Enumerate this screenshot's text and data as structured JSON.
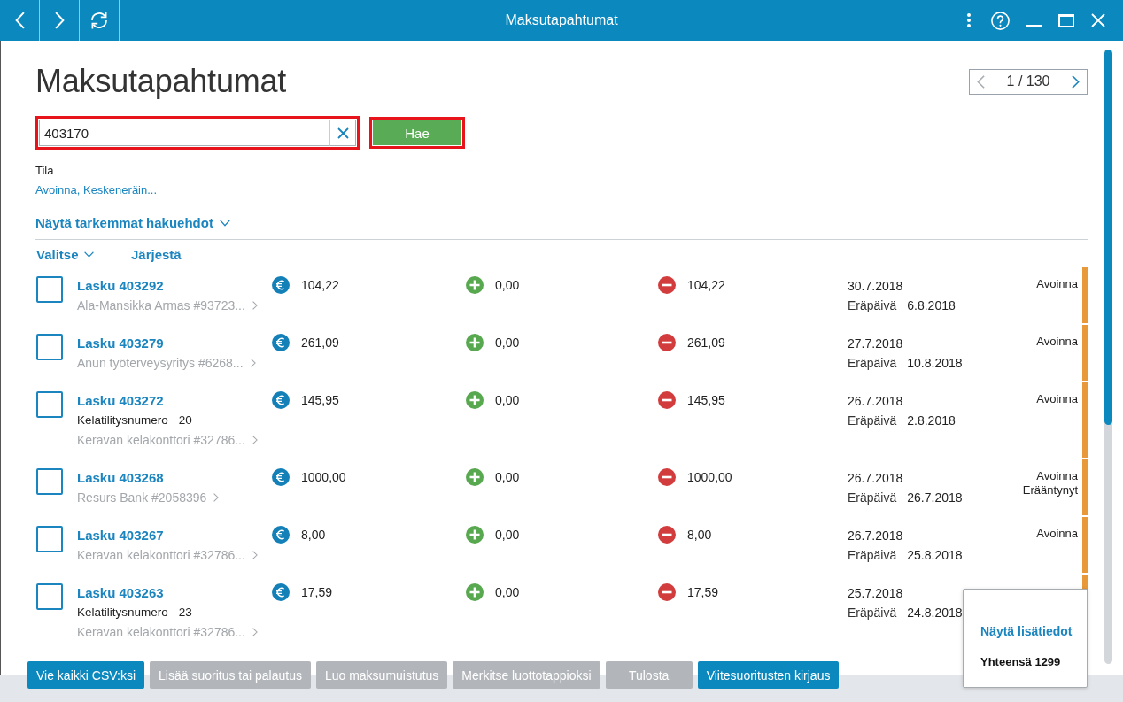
{
  "window": {
    "title": "Maksutapahtumat"
  },
  "page": {
    "title": "Maksutapahtumat",
    "pager": {
      "text": "1 / 130",
      "prev": {
        "disabled": true
      },
      "next": {
        "disabled": false
      }
    }
  },
  "search": {
    "value": "403170",
    "highlighted": true,
    "button": {
      "label": "Hae",
      "highlighted": true
    }
  },
  "filter": {
    "label": "Tila",
    "value": "Avoinna, Keskeneräin..."
  },
  "advanced_toggle": {
    "label": "Näytä tarkemmat hakuehdot",
    "expanded": false
  },
  "list_toolbar": {
    "select": "Valitse",
    "sort": "Järjestä"
  },
  "rows": [
    {
      "checked": false,
      "title": "Lasku 403292",
      "payer": "Ala-Mansikka Armas #93723...",
      "amount": "104,22",
      "paid": "0,00",
      "remaining": "104,22",
      "date": "30.7.2018",
      "due_label": "Eräpäivä",
      "due": "6.8.2018",
      "status": [
        "Avoinna"
      ],
      "color": "#e8993a"
    },
    {
      "checked": false,
      "title": "Lasku 403279",
      "payer": "Anun työterveysyritys #6268...",
      "amount": "261,09",
      "paid": "0,00",
      "remaining": "261,09",
      "date": "27.7.2018",
      "due_label": "Eräpäivä",
      "due": "10.8.2018",
      "status": [
        "Avoinna"
      ],
      "color": "#e8993a"
    },
    {
      "checked": false,
      "title": "Lasku 403272",
      "reference": {
        "label": "Kelatilitysnumero",
        "value": "20"
      },
      "payer": "Keravan kelakonttori #32786...",
      "amount": "145,95",
      "paid": "0,00",
      "remaining": "145,95",
      "date": "26.7.2018",
      "due_label": "Eräpäivä",
      "due": "2.8.2018",
      "status": [
        "Avoinna"
      ],
      "color": "#e8993a"
    },
    {
      "checked": false,
      "title": "Lasku 403268",
      "payer": "Resurs Bank #2058396",
      "amount": "1000,00",
      "paid": "0,00",
      "remaining": "1000,00",
      "date": "26.7.2018",
      "due_label": "Eräpäivä",
      "due": "26.7.2018",
      "status": [
        "Avoinna",
        "Erääntynyt"
      ],
      "color": "#e8993a"
    },
    {
      "checked": false,
      "title": "Lasku 403267",
      "payer": "Keravan kelakonttori #32786...",
      "amount": "8,00",
      "paid": "0,00",
      "remaining": "8,00",
      "date": "26.7.2018",
      "due_label": "Eräpäivä",
      "due": "25.8.2018",
      "status": [
        "Avoinna"
      ],
      "color": "#e8993a"
    },
    {
      "checked": false,
      "title": "Lasku 403263",
      "reference": {
        "label": "Kelatilitysnumero",
        "value": "23"
      },
      "payer": "Keravan kelakonttori #32786...",
      "amount": "17,59",
      "paid": "0,00",
      "remaining": "17,59",
      "date": "25.7.2018",
      "due_label": "Eräpäivä",
      "due": "24.8.2018",
      "color": "#e8993a"
    }
  ],
  "popup": {
    "link": "Näytä lisätiedot",
    "total": "Yhteensä 1299"
  },
  "actions": [
    {
      "label": "Vie kaikki CSV:ksi",
      "disabled": false
    },
    {
      "label": "Lisää suoritus tai palautus",
      "disabled": true
    },
    {
      "label": "Luo maksumuistutus",
      "disabled": true
    },
    {
      "label": "Merkitse luottotappioksi",
      "disabled": true
    },
    {
      "label": "Tulosta",
      "disabled": true
    },
    {
      "label": "Viitesuoritusten kirjaus",
      "disabled": false
    }
  ]
}
